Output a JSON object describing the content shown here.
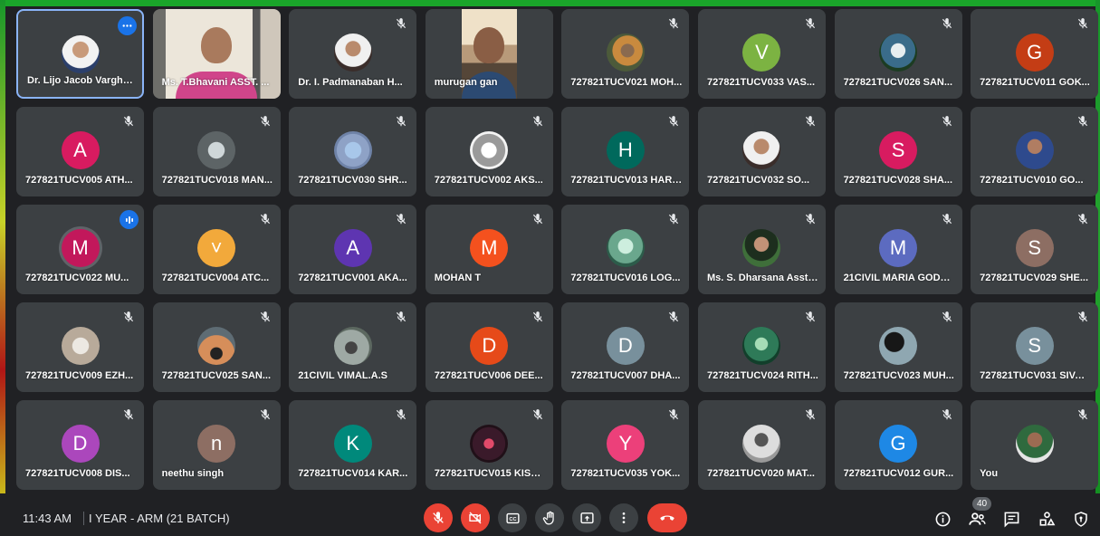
{
  "participants": [
    {
      "name": "Dr. Lijo Jacob Varghe...",
      "kind": "photo",
      "style": "p1",
      "badge": "more"
    },
    {
      "name": "Ms. T.Bhavani ASST. ...",
      "kind": "video",
      "style": "v1"
    },
    {
      "name": "Dr. I. Padmanaban H...",
      "kind": "photo",
      "style": "p7",
      "muted": true
    },
    {
      "name": "murugan gan",
      "kind": "video",
      "style": "v2"
    },
    {
      "name": "727821TUCV021 MOH...",
      "kind": "photo",
      "style": "p2",
      "muted": true
    },
    {
      "name": "727821TUCV033 VAS...",
      "kind": "initial",
      "initial": "V",
      "color": "#7cb342",
      "muted": true
    },
    {
      "name": "727821TUCV026 SAN...",
      "kind": "photo",
      "style": "p3",
      "muted": true
    },
    {
      "name": "727821TUCV011 GOK...",
      "kind": "initial",
      "initial": "G",
      "color": "#c43d15",
      "muted": true
    },
    {
      "name": "727821TUCV005 ATH...",
      "kind": "initial",
      "initial": "A",
      "color": "#d81b60",
      "muted": true
    },
    {
      "name": "727821TUCV018 MAN...",
      "kind": "photo",
      "style": "p4",
      "muted": true
    },
    {
      "name": "727821TUCV030 SHR...",
      "kind": "photo",
      "style": "p5",
      "muted": true
    },
    {
      "name": "727821TUCV002 AKS...",
      "kind": "photo",
      "style": "p6",
      "muted": true
    },
    {
      "name": "727821TUCV013 HARI...",
      "kind": "initial",
      "initial": "H",
      "color": "#00695c",
      "muted": true
    },
    {
      "name": "727821TUCV032 SO...",
      "kind": "photo",
      "style": "p7",
      "muted": true
    },
    {
      "name": "727821TUCV028 SHA...",
      "kind": "initial",
      "initial": "S",
      "color": "#d81b60",
      "muted": true
    },
    {
      "name": "727821TUCV010 GO...",
      "kind": "photo",
      "style": "p8",
      "muted": true
    },
    {
      "name": "727821TUCV022 MU...",
      "kind": "initial",
      "initial": "M",
      "color": "#c2185b",
      "badge": "speaking",
      "ring": true
    },
    {
      "name": "727821TUCV004 ATC...",
      "kind": "initial",
      "initial": "˅",
      "color": "#f2a93b",
      "muted": true
    },
    {
      "name": "727821TUCV001 AKA...",
      "kind": "initial",
      "initial": "A",
      "color": "#5e35b1",
      "muted": true
    },
    {
      "name": "MOHAN T",
      "kind": "initial",
      "initial": "M",
      "color": "#f4511e",
      "muted": true
    },
    {
      "name": "727821TUCV016 LOG...",
      "kind": "photo",
      "style": "p9",
      "muted": true
    },
    {
      "name": "Ms. S. Dharsana Asst ...",
      "kind": "photo",
      "style": "p10",
      "muted": true
    },
    {
      "name": "21CIVIL MARIA GODS...",
      "kind": "initial",
      "initial": "M",
      "color": "#5c6bc0",
      "muted": true
    },
    {
      "name": "727821TUCV029 SHE...",
      "kind": "initial",
      "initial": "S",
      "color": "#8d6e63",
      "muted": true
    },
    {
      "name": "727821TUCV009 EZH...",
      "kind": "photo",
      "style": "p11",
      "muted": true
    },
    {
      "name": "727821TUCV025 SAN...",
      "kind": "photo",
      "style": "p12",
      "muted": true
    },
    {
      "name": "21CIVIL VIMAL.A.S",
      "kind": "photo",
      "style": "p13",
      "muted": true
    },
    {
      "name": "727821TUCV006 DEE...",
      "kind": "initial",
      "initial": "D",
      "color": "#e64a19",
      "muted": true
    },
    {
      "name": "727821TUCV007 DHA...",
      "kind": "initial",
      "initial": "D",
      "color": "#78909c",
      "muted": true
    },
    {
      "name": "727821TUCV024 RITH...",
      "kind": "photo",
      "style": "p14",
      "muted": true
    },
    {
      "name": "727821TUCV023 MUH...",
      "kind": "photo",
      "style": "p15",
      "muted": true
    },
    {
      "name": "727821TUCV031 SIVA ...",
      "kind": "initial",
      "initial": "S",
      "color": "#78909c",
      "muted": true
    },
    {
      "name": "727821TUCV008 DIS...",
      "kind": "initial",
      "initial": "D",
      "color": "#ab47bc",
      "muted": true
    },
    {
      "name": "neethu singh",
      "kind": "initial",
      "initial": "n",
      "color": "#8d6e63",
      "muted": true
    },
    {
      "name": "727821TUCV014 KAR...",
      "kind": "initial",
      "initial": "K",
      "color": "#00897b",
      "muted": true
    },
    {
      "name": "727821TUCV015 KISH...",
      "kind": "photo",
      "style": "p16",
      "muted": true
    },
    {
      "name": "727821TUCV035 YOK...",
      "kind": "initial",
      "initial": "Y",
      "color": "#ec407a",
      "muted": true
    },
    {
      "name": "727821TUCV020 MAT...",
      "kind": "photo",
      "style": "p17",
      "muted": true
    },
    {
      "name": "727821TUCV012 GUR...",
      "kind": "initial",
      "initial": "G",
      "color": "#1e88e5",
      "muted": true
    },
    {
      "name": "You",
      "kind": "photo",
      "style": "p18",
      "muted": true
    }
  ],
  "bottom_bar": {
    "time": "11:43 AM",
    "meeting_title": "I YEAR - ARM (21 BATCH)",
    "participant_count": "40"
  },
  "controls": [
    "mic-off-icon",
    "camera-off-icon",
    "captions-icon",
    "raise-hand-icon",
    "present-icon",
    "more-options-icon",
    "end-call-icon"
  ],
  "right_icons": [
    "info-icon",
    "people-icon",
    "chat-icon",
    "activities-icon",
    "host-controls-icon"
  ],
  "colors": {
    "tile_bg": "#3c4043",
    "page_bg": "#202124",
    "accent_blue": "#1a73e8",
    "danger_red": "#ea4335"
  }
}
